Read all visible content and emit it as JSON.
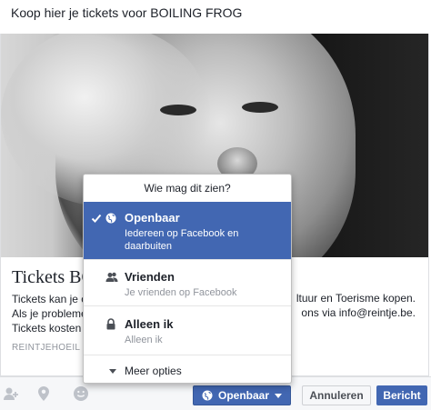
{
  "composer": {
    "text": "Koop hier je tickets voor BOILING FROG"
  },
  "link_card": {
    "title": "Tickets BO",
    "description_lines": [
      "Tickets kan je o",
      "Als je probleme",
      "Tickets kosten "
    ],
    "description_right": [
      "ltuur en Toerisme kopen.",
      "ons via info@reintje.be."
    ],
    "domain": "REINTJEHOEIL"
  },
  "privacy_menu": {
    "header": "Wie mag dit zien?",
    "options": [
      {
        "label": "Openbaar",
        "sub": "Iedereen op Facebook en daarbuiten",
        "icon": "globe-icon",
        "selected": true
      },
      {
        "label": "Vrienden",
        "sub": "Je vrienden op Facebook",
        "icon": "friends-icon",
        "selected": false
      },
      {
        "label": "Alleen ik",
        "sub": "Alleen ik",
        "icon": "lock-icon",
        "selected": false
      }
    ],
    "more": "Meer opties"
  },
  "toolbar": {
    "privacy_label": "Openbaar",
    "cancel_label": "Annuleren",
    "post_label": "Bericht",
    "icons": [
      "tag-friends-icon",
      "location-icon",
      "feeling-icon"
    ]
  },
  "colors": {
    "accent": "#4267b2",
    "muted": "#90949c"
  }
}
